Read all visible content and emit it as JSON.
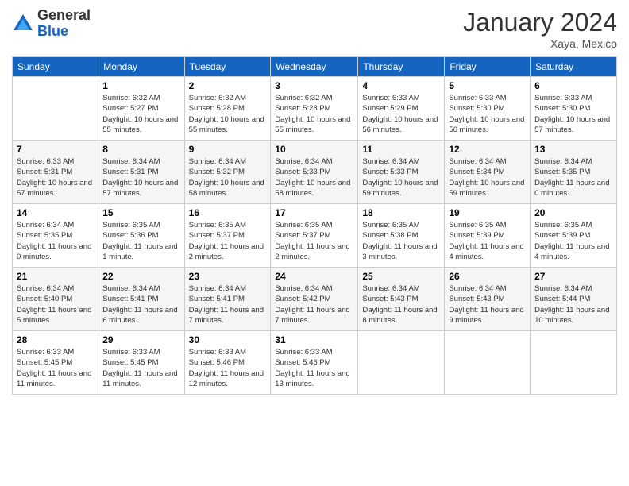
{
  "logo": {
    "general": "General",
    "blue": "Blue"
  },
  "title": "January 2024",
  "location": "Xaya, Mexico",
  "days_header": [
    "Sunday",
    "Monday",
    "Tuesday",
    "Wednesday",
    "Thursday",
    "Friday",
    "Saturday"
  ],
  "weeks": [
    [
      {
        "day": "",
        "sunrise": "",
        "sunset": "",
        "daylight": ""
      },
      {
        "day": "1",
        "sunrise": "Sunrise: 6:32 AM",
        "sunset": "Sunset: 5:27 PM",
        "daylight": "Daylight: 10 hours and 55 minutes."
      },
      {
        "day": "2",
        "sunrise": "Sunrise: 6:32 AM",
        "sunset": "Sunset: 5:28 PM",
        "daylight": "Daylight: 10 hours and 55 minutes."
      },
      {
        "day": "3",
        "sunrise": "Sunrise: 6:32 AM",
        "sunset": "Sunset: 5:28 PM",
        "daylight": "Daylight: 10 hours and 55 minutes."
      },
      {
        "day": "4",
        "sunrise": "Sunrise: 6:33 AM",
        "sunset": "Sunset: 5:29 PM",
        "daylight": "Daylight: 10 hours and 56 minutes."
      },
      {
        "day": "5",
        "sunrise": "Sunrise: 6:33 AM",
        "sunset": "Sunset: 5:30 PM",
        "daylight": "Daylight: 10 hours and 56 minutes."
      },
      {
        "day": "6",
        "sunrise": "Sunrise: 6:33 AM",
        "sunset": "Sunset: 5:30 PM",
        "daylight": "Daylight: 10 hours and 57 minutes."
      }
    ],
    [
      {
        "day": "7",
        "sunrise": "Sunrise: 6:33 AM",
        "sunset": "Sunset: 5:31 PM",
        "daylight": "Daylight: 10 hours and 57 minutes."
      },
      {
        "day": "8",
        "sunrise": "Sunrise: 6:34 AM",
        "sunset": "Sunset: 5:31 PM",
        "daylight": "Daylight: 10 hours and 57 minutes."
      },
      {
        "day": "9",
        "sunrise": "Sunrise: 6:34 AM",
        "sunset": "Sunset: 5:32 PM",
        "daylight": "Daylight: 10 hours and 58 minutes."
      },
      {
        "day": "10",
        "sunrise": "Sunrise: 6:34 AM",
        "sunset": "Sunset: 5:33 PM",
        "daylight": "Daylight: 10 hours and 58 minutes."
      },
      {
        "day": "11",
        "sunrise": "Sunrise: 6:34 AM",
        "sunset": "Sunset: 5:33 PM",
        "daylight": "Daylight: 10 hours and 59 minutes."
      },
      {
        "day": "12",
        "sunrise": "Sunrise: 6:34 AM",
        "sunset": "Sunset: 5:34 PM",
        "daylight": "Daylight: 10 hours and 59 minutes."
      },
      {
        "day": "13",
        "sunrise": "Sunrise: 6:34 AM",
        "sunset": "Sunset: 5:35 PM",
        "daylight": "Daylight: 11 hours and 0 minutes."
      }
    ],
    [
      {
        "day": "14",
        "sunrise": "Sunrise: 6:34 AM",
        "sunset": "Sunset: 5:35 PM",
        "daylight": "Daylight: 11 hours and 0 minutes."
      },
      {
        "day": "15",
        "sunrise": "Sunrise: 6:35 AM",
        "sunset": "Sunset: 5:36 PM",
        "daylight": "Daylight: 11 hours and 1 minute."
      },
      {
        "day": "16",
        "sunrise": "Sunrise: 6:35 AM",
        "sunset": "Sunset: 5:37 PM",
        "daylight": "Daylight: 11 hours and 2 minutes."
      },
      {
        "day": "17",
        "sunrise": "Sunrise: 6:35 AM",
        "sunset": "Sunset: 5:37 PM",
        "daylight": "Daylight: 11 hours and 2 minutes."
      },
      {
        "day": "18",
        "sunrise": "Sunrise: 6:35 AM",
        "sunset": "Sunset: 5:38 PM",
        "daylight": "Daylight: 11 hours and 3 minutes."
      },
      {
        "day": "19",
        "sunrise": "Sunrise: 6:35 AM",
        "sunset": "Sunset: 5:39 PM",
        "daylight": "Daylight: 11 hours and 4 minutes."
      },
      {
        "day": "20",
        "sunrise": "Sunrise: 6:35 AM",
        "sunset": "Sunset: 5:39 PM",
        "daylight": "Daylight: 11 hours and 4 minutes."
      }
    ],
    [
      {
        "day": "21",
        "sunrise": "Sunrise: 6:34 AM",
        "sunset": "Sunset: 5:40 PM",
        "daylight": "Daylight: 11 hours and 5 minutes."
      },
      {
        "day": "22",
        "sunrise": "Sunrise: 6:34 AM",
        "sunset": "Sunset: 5:41 PM",
        "daylight": "Daylight: 11 hours and 6 minutes."
      },
      {
        "day": "23",
        "sunrise": "Sunrise: 6:34 AM",
        "sunset": "Sunset: 5:41 PM",
        "daylight": "Daylight: 11 hours and 7 minutes."
      },
      {
        "day": "24",
        "sunrise": "Sunrise: 6:34 AM",
        "sunset": "Sunset: 5:42 PM",
        "daylight": "Daylight: 11 hours and 7 minutes."
      },
      {
        "day": "25",
        "sunrise": "Sunrise: 6:34 AM",
        "sunset": "Sunset: 5:43 PM",
        "daylight": "Daylight: 11 hours and 8 minutes."
      },
      {
        "day": "26",
        "sunrise": "Sunrise: 6:34 AM",
        "sunset": "Sunset: 5:43 PM",
        "daylight": "Daylight: 11 hours and 9 minutes."
      },
      {
        "day": "27",
        "sunrise": "Sunrise: 6:34 AM",
        "sunset": "Sunset: 5:44 PM",
        "daylight": "Daylight: 11 hours and 10 minutes."
      }
    ],
    [
      {
        "day": "28",
        "sunrise": "Sunrise: 6:33 AM",
        "sunset": "Sunset: 5:45 PM",
        "daylight": "Daylight: 11 hours and 11 minutes."
      },
      {
        "day": "29",
        "sunrise": "Sunrise: 6:33 AM",
        "sunset": "Sunset: 5:45 PM",
        "daylight": "Daylight: 11 hours and 11 minutes."
      },
      {
        "day": "30",
        "sunrise": "Sunrise: 6:33 AM",
        "sunset": "Sunset: 5:46 PM",
        "daylight": "Daylight: 11 hours and 12 minutes."
      },
      {
        "day": "31",
        "sunrise": "Sunrise: 6:33 AM",
        "sunset": "Sunset: 5:46 PM",
        "daylight": "Daylight: 11 hours and 13 minutes."
      },
      {
        "day": "",
        "sunrise": "",
        "sunset": "",
        "daylight": ""
      },
      {
        "day": "",
        "sunrise": "",
        "sunset": "",
        "daylight": ""
      },
      {
        "day": "",
        "sunrise": "",
        "sunset": "",
        "daylight": ""
      }
    ]
  ]
}
